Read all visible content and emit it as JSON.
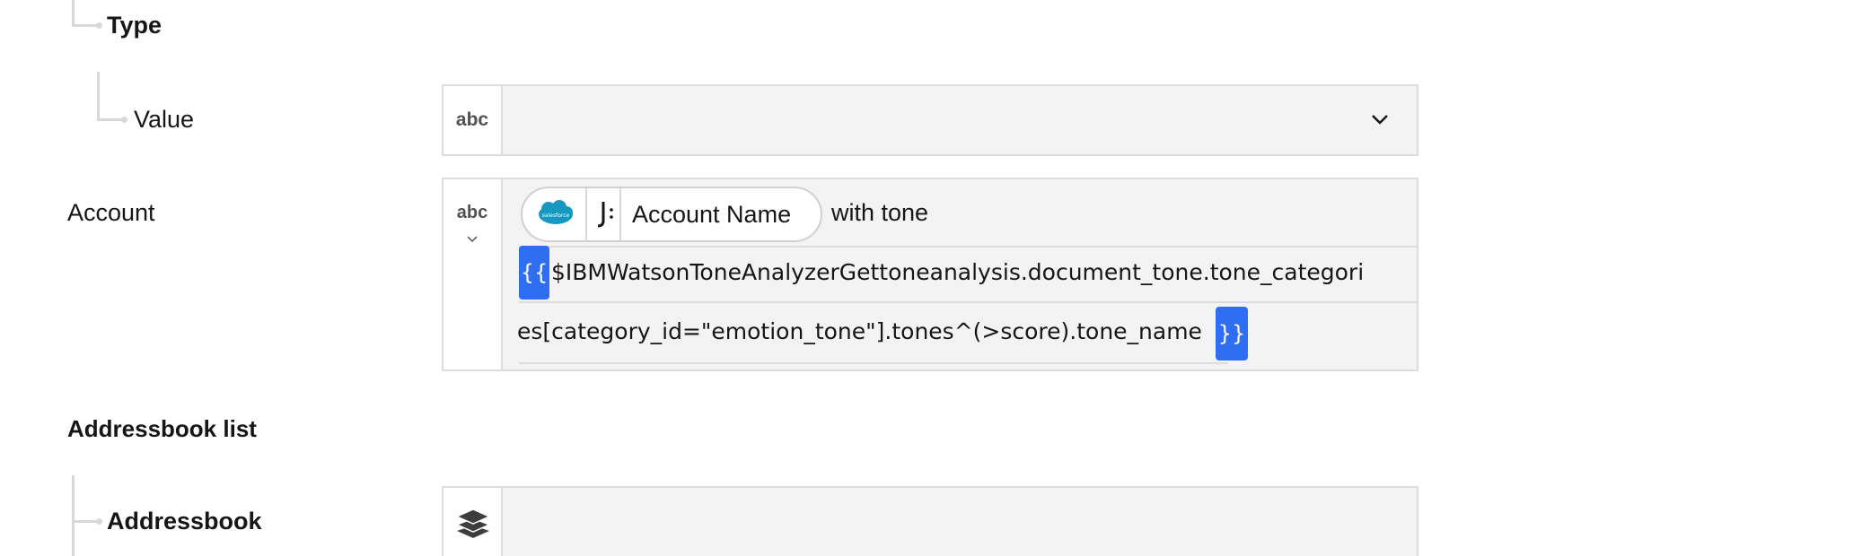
{
  "tree": {
    "type_label": "Type",
    "value_label": "Value",
    "account_label": "Account",
    "addressbook_list_label": "Addressbook list",
    "addressbook_label": "Addressbook"
  },
  "fields": {
    "value": {
      "type_badge": "abc",
      "dropdown_icon": "chevron-down-icon"
    },
    "account": {
      "type_badge": "abc",
      "pill_label": "Account Name",
      "pill_app_icon": "salesforce-icon",
      "pill_app_icon_text": "salesforce",
      "pill_func_icon": "function-icon",
      "after_pill_text": "with tone",
      "expression_open": "{{",
      "expression_line1": "$IBMWatsonToneAnalyzerGettoneanalysis.document_tone.tone_categori",
      "expression_line2": "es[category_id=\"emotion_tone\"].tones^(>score).tone_name",
      "expression_close": "}}"
    },
    "addressbook": {
      "type_icon": "layers-icon"
    }
  },
  "colors": {
    "accent": "#2f6ef0",
    "field_bg": "#f3f3f3",
    "border": "#dcdcdc",
    "salesforce": "#1798c1"
  }
}
